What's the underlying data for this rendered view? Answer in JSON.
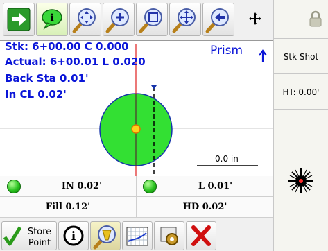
{
  "plan": {
    "line1": "Stk: 6+00.00 C 0.000",
    "line2": "Actual: 6+00.01 L 0.020",
    "line3": "Back Sta 0.01'",
    "line4": "In CL 0.02'",
    "prism_label": "Prism",
    "scale_label": "0.0 in"
  },
  "sidebar": {
    "stk_shot": "Stk Shot",
    "ht": "HT: 0.00'"
  },
  "info": {
    "in_value": "IN 0.02'",
    "l_value": "L 0.01'",
    "fill_value": "Fill 0.12'",
    "hd_value": "HD 0.02'"
  },
  "bottom": {
    "store_line1": "Store",
    "store_line2": "Point"
  },
  "icons": {
    "toolbar": [
      "arrow-right-icon",
      "info-bubble-icon",
      "zoom-extents-icon",
      "zoom-in-icon",
      "zoom-window-icon",
      "pan-icon",
      "zoom-previous-icon",
      "crosshair-add-icon",
      "lock-icon"
    ],
    "bottom": [
      "checkmark-icon",
      "info-icon",
      "target-select-icon",
      "chart-icon",
      "settings-icon",
      "close-icon"
    ],
    "side": "laser-target-icon"
  },
  "colors": {
    "accent_green": "#2ecc2e",
    "text_blue": "#0b16d8",
    "target_fill": "#33e033"
  }
}
